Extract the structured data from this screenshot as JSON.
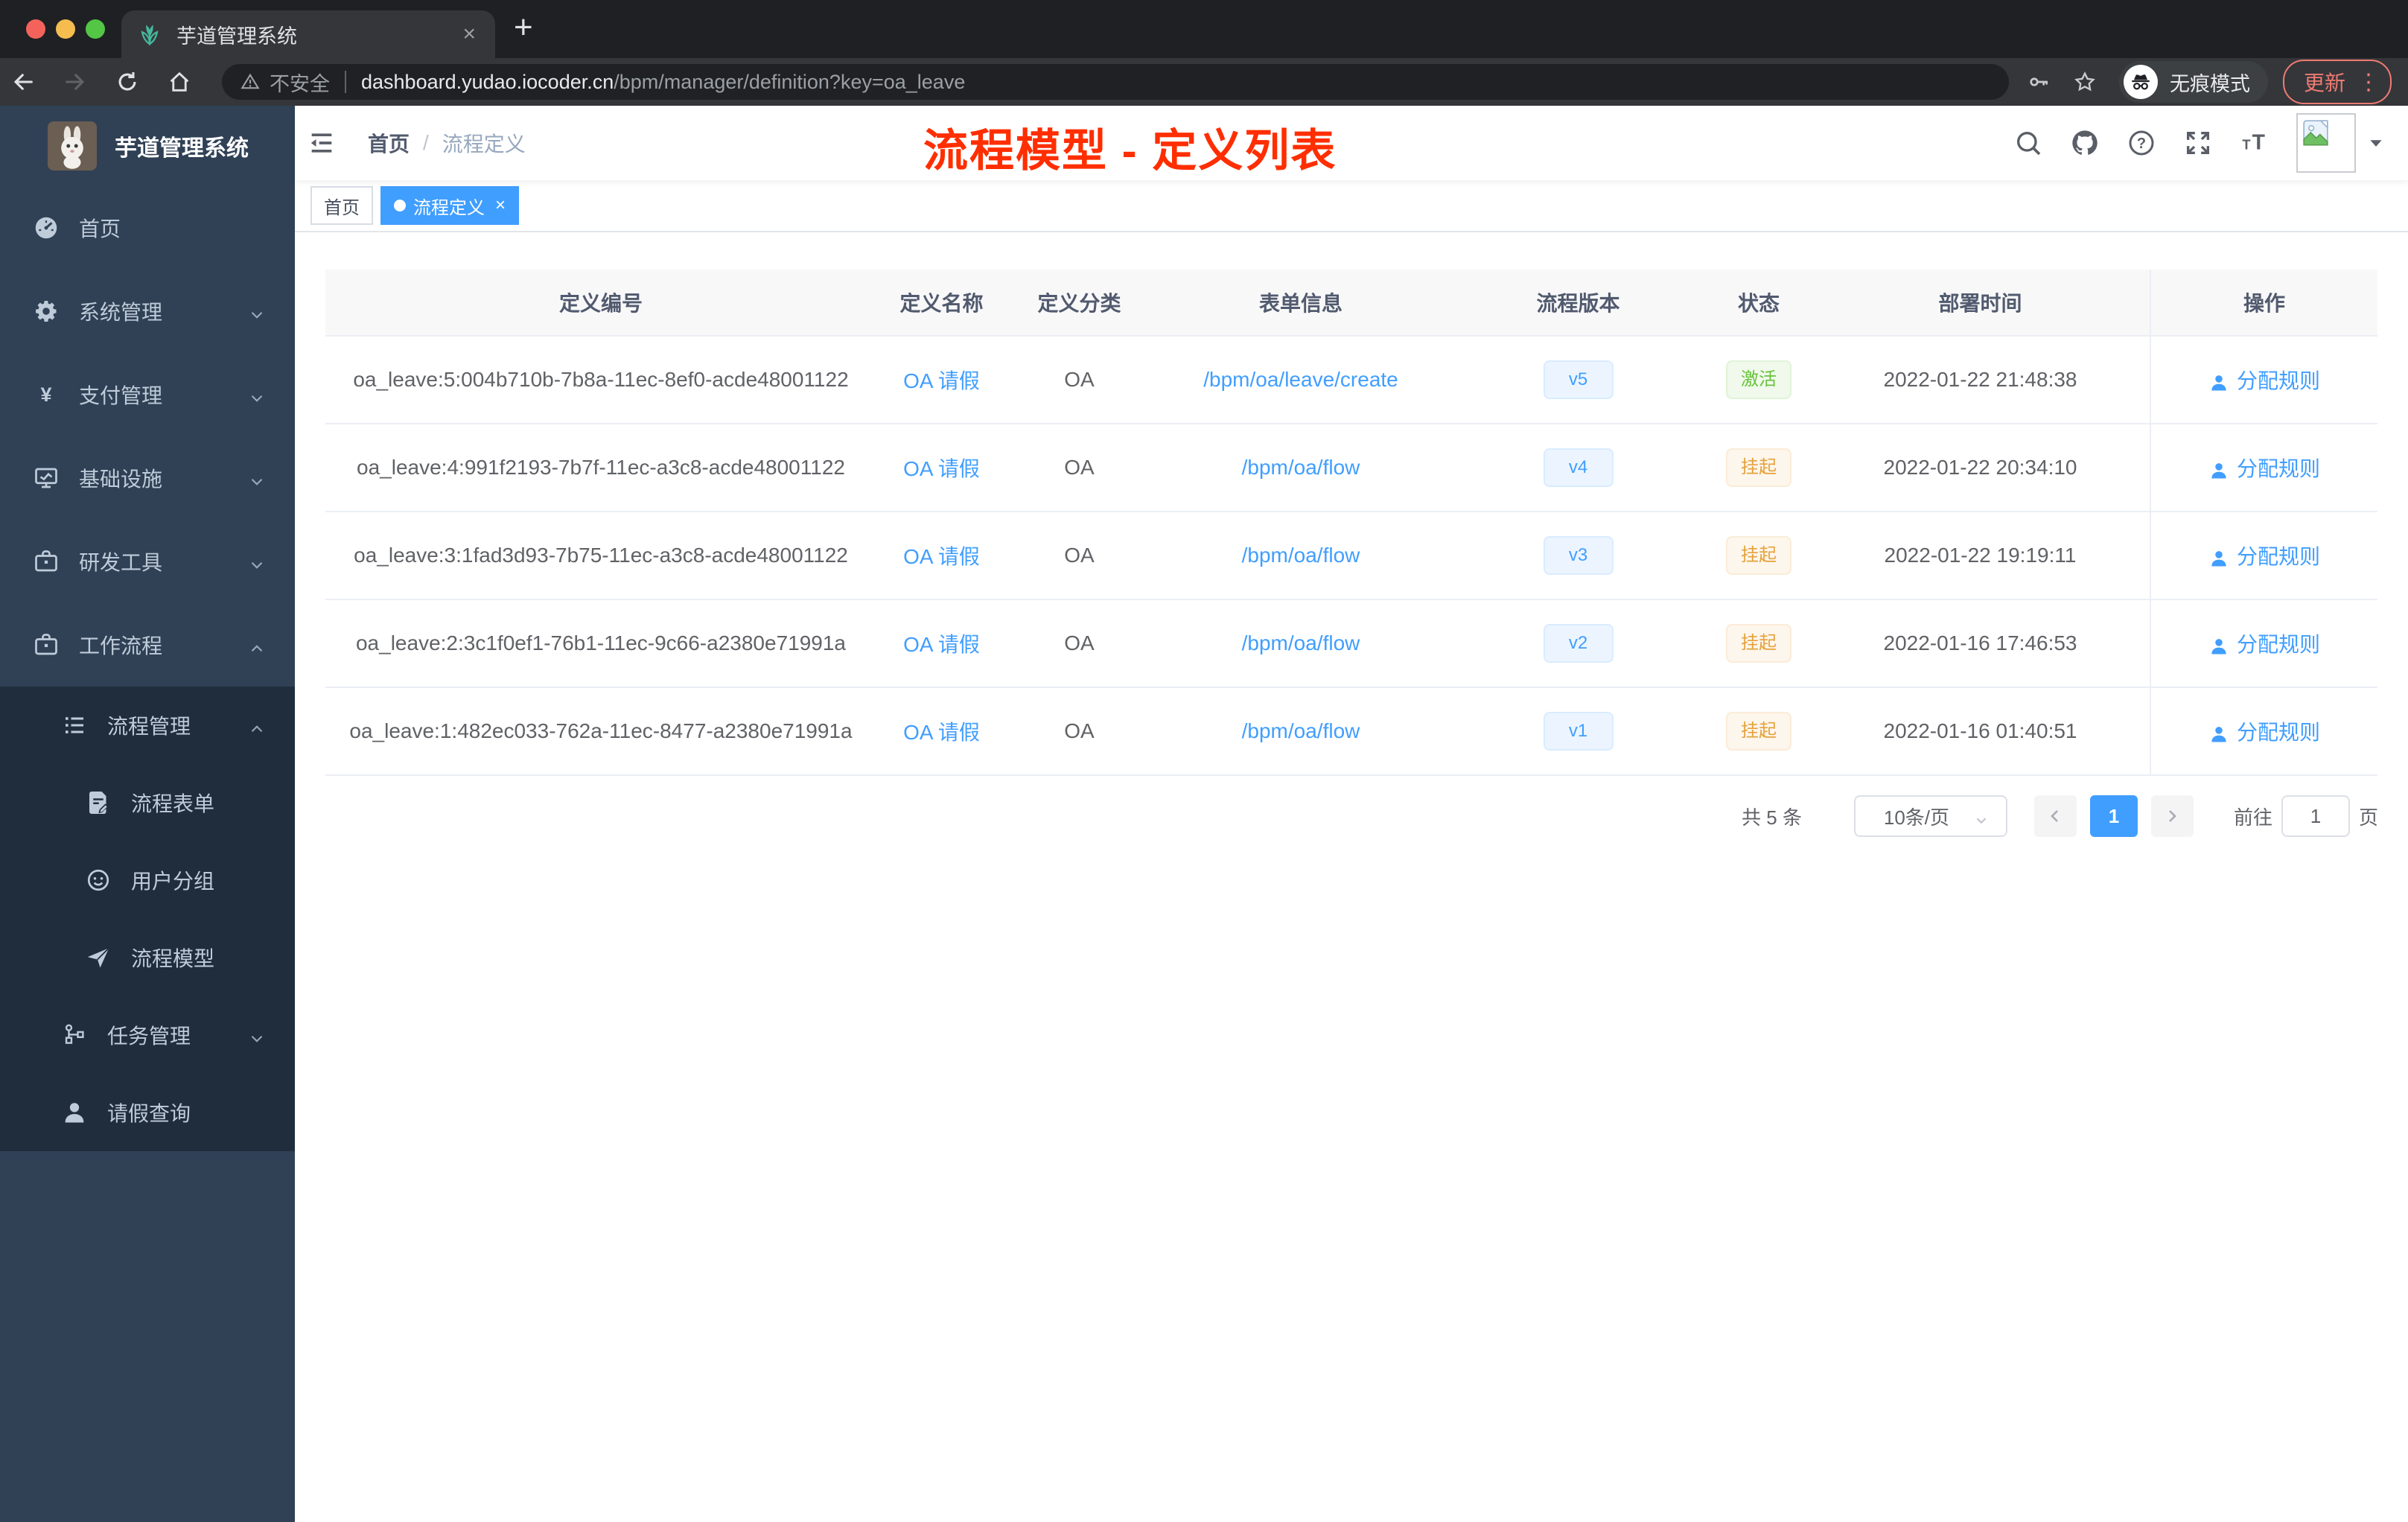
{
  "browser": {
    "tab": {
      "title": "芋道管理系统",
      "favicon": "plant-icon",
      "close": "×"
    },
    "new_tab": "+",
    "address": {
      "security_label": "不安全",
      "host": "dashboard.yudao.iocoder.cn",
      "path": "/bpm/manager/definition?key=oa_leave"
    },
    "incognito_label": "无痕模式",
    "update_label": "更新",
    "menu_dots": "⋮"
  },
  "sidebar": {
    "logo_title": "芋道管理系统",
    "items": [
      {
        "key": "home",
        "label": "首页",
        "icon": "dashboard-icon",
        "level": 1
      },
      {
        "key": "system",
        "label": "系统管理",
        "icon": "gear-icon",
        "level": 1,
        "arrow": "down"
      },
      {
        "key": "payment",
        "label": "支付管理",
        "icon": "yen-icon",
        "level": 1,
        "arrow": "down"
      },
      {
        "key": "infrastructure",
        "label": "基础设施",
        "icon": "monitor-icon",
        "level": 1,
        "arrow": "down"
      },
      {
        "key": "devtools",
        "label": "研发工具",
        "icon": "briefcase-icon",
        "level": 1,
        "arrow": "down"
      },
      {
        "key": "workflow",
        "label": "工作流程",
        "icon": "briefcase-icon",
        "level": 1,
        "arrow": "up"
      },
      {
        "key": "process-management",
        "label": "流程管理",
        "icon": "list-icon",
        "level": 2,
        "arrow": "up",
        "dark": true
      },
      {
        "key": "process-form",
        "label": "流程表单",
        "icon": "form-icon",
        "level": 3,
        "dark": true
      },
      {
        "key": "user-group",
        "label": "用户分组",
        "icon": "face-icon",
        "level": 3,
        "dark": true
      },
      {
        "key": "process-model",
        "label": "流程模型",
        "icon": "send-icon",
        "level": 3,
        "dark": true
      },
      {
        "key": "task-management",
        "label": "任务管理",
        "icon": "tree-icon",
        "level": 2,
        "arrow": "down",
        "dark": true
      },
      {
        "key": "leave-query",
        "label": "请假查询",
        "icon": "user-icon",
        "level": 2,
        "dark": true
      }
    ]
  },
  "navbar": {
    "breadcrumb_home": "首页",
    "breadcrumb_separator": "/",
    "breadcrumb_current": "流程定义",
    "annotation": "流程模型 - 定义列表"
  },
  "tags": {
    "inactive": "首页",
    "active": "流程定义",
    "close": "×"
  },
  "table": {
    "columns": [
      "定义编号",
      "定义名称",
      "定义分类",
      "表单信息",
      "流程版本",
      "状态",
      "部署时间",
      "操作"
    ],
    "rows": [
      {
        "id": "oa_leave:5:004b710b-7b8a-11ec-8ef0-acde48001122",
        "name": "OA 请假",
        "category": "OA",
        "form": "/bpm/oa/leave/create",
        "version": "v5",
        "status": "激活",
        "status_type": "success",
        "time": "2022-01-22 21:48:38",
        "action": "分配规则"
      },
      {
        "id": "oa_leave:4:991f2193-7b7f-11ec-a3c8-acde48001122",
        "name": "OA 请假",
        "category": "OA",
        "form": "/bpm/oa/flow",
        "version": "v4",
        "status": "挂起",
        "status_type": "warning",
        "time": "2022-01-22 20:34:10",
        "action": "分配规则"
      },
      {
        "id": "oa_leave:3:1fad3d93-7b75-11ec-a3c8-acde48001122",
        "name": "OA 请假",
        "category": "OA",
        "form": "/bpm/oa/flow",
        "version": "v3",
        "status": "挂起",
        "status_type": "warning",
        "time": "2022-01-22 19:19:11",
        "action": "分配规则"
      },
      {
        "id": "oa_leave:2:3c1f0ef1-76b1-11ec-9c66-a2380e71991a",
        "name": "OA 请假",
        "category": "OA",
        "form": "/bpm/oa/flow",
        "version": "v2",
        "status": "挂起",
        "status_type": "warning",
        "time": "2022-01-16 17:46:53",
        "action": "分配规则"
      },
      {
        "id": "oa_leave:1:482ec033-762a-11ec-8477-a2380e71991a",
        "name": "OA 请假",
        "category": "OA",
        "form": "/bpm/oa/flow",
        "version": "v1",
        "status": "挂起",
        "status_type": "warning",
        "time": "2022-01-16 01:40:51",
        "action": "分配规则"
      }
    ]
  },
  "pagination": {
    "total": "共 5 条",
    "page_size": "10条/页",
    "current": "1",
    "goto_label": "前往",
    "goto_value": "1",
    "unit": "页"
  },
  "colors": {
    "accent": "#409eff",
    "success": "#67c23a",
    "warning": "#e6a23c",
    "annotation_red": "#ff2e00",
    "sidebar_bg": "#304156",
    "sidebar_submenu_bg": "#1f2d3d"
  }
}
